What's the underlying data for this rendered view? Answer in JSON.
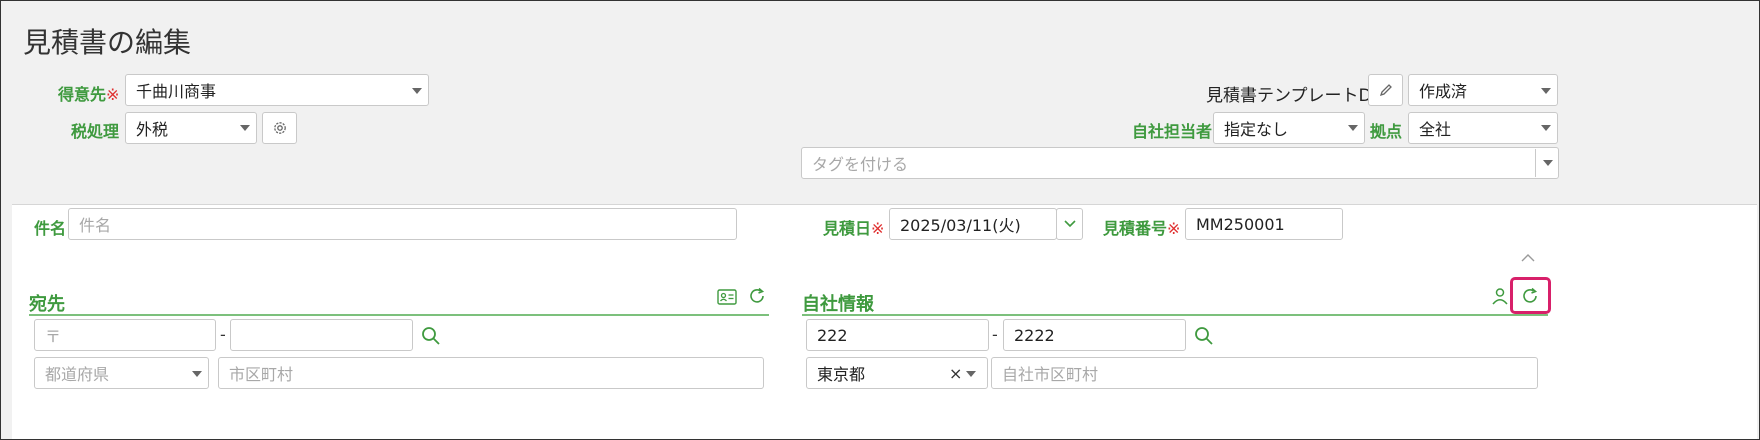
{
  "page": {
    "title": "見積書の編集"
  },
  "header": {
    "customer": {
      "label": "得意先",
      "required": "※",
      "value": "千曲川商事"
    },
    "tax": {
      "label": "税処理",
      "value": "外税"
    },
    "template": {
      "name": "見積書テンプレートD"
    },
    "status": {
      "value": "作成済"
    },
    "staff": {
      "label": "自社担当者",
      "value": "指定なし"
    },
    "branch": {
      "label": "拠点",
      "value": "全社"
    },
    "tags": {
      "placeholder": "タグを付ける"
    }
  },
  "form": {
    "subject": {
      "label": "件名",
      "placeholder": "件名"
    },
    "date": {
      "label": "見積日",
      "required": "※",
      "value": "2025/03/11(火)"
    },
    "number": {
      "label": "見積番号",
      "required": "※",
      "value": "MM250001"
    }
  },
  "recipient": {
    "title": "宛先",
    "postal_placeholder": "〒",
    "dash": "-",
    "prefecture_placeholder": "都道府県",
    "city_placeholder": "市区町村"
  },
  "company": {
    "title": "自社情報",
    "postal1": "222",
    "dash": "-",
    "postal2": "2222",
    "prefecture": "東京都",
    "clear": "×",
    "city_placeholder": "自社市区町村"
  },
  "colors": {
    "accent": "#3f9a3f",
    "required": "#e03030",
    "highlight": "#d8206a"
  }
}
